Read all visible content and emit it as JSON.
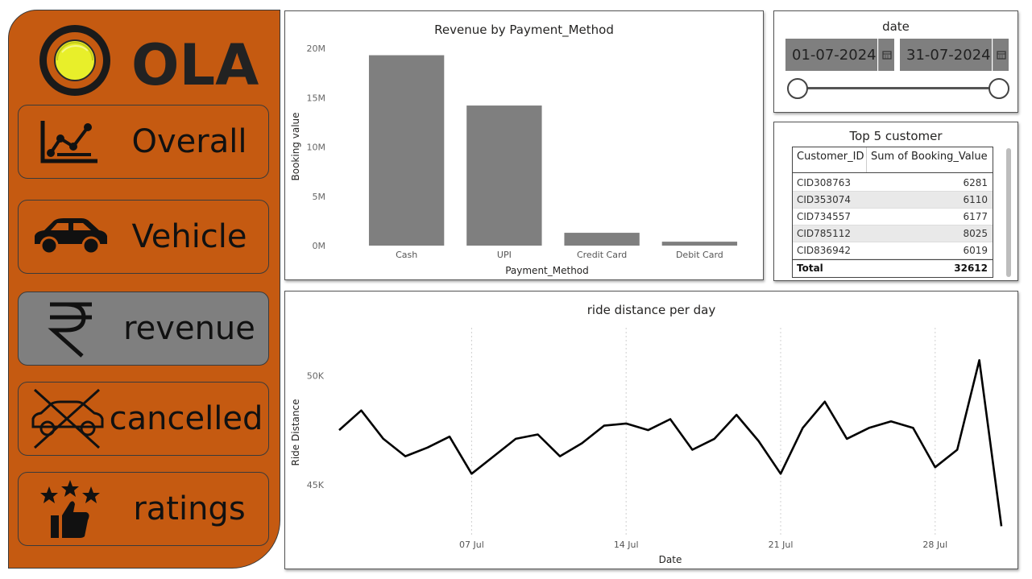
{
  "sidebar": {
    "brand": "OLA",
    "items": [
      {
        "label": "Overall",
        "icon": "line-chart-icon",
        "active": false
      },
      {
        "label": "Vehicle",
        "icon": "car-icon",
        "active": false
      },
      {
        "label": "revenue",
        "icon": "rupee-icon",
        "active": true
      },
      {
        "label": "cancelled",
        "icon": "cancelled-car-icon",
        "active": false
      },
      {
        "label": "ratings",
        "icon": "star-thumbs-up-icon",
        "active": false
      }
    ]
  },
  "colors": {
    "sidebar_bg": "#c55a11",
    "active_item": "#7f7f7f",
    "bar": "#7f7f7f",
    "line": "#000000"
  },
  "date_slicer": {
    "title": "date",
    "start": "01-07-2024",
    "end": "31-07-2024",
    "icon": "calendar-icon"
  },
  "top_customers": {
    "title": "Top 5 customer",
    "columns": [
      "Customer_ID",
      "Sum of Booking_Value"
    ],
    "rows": [
      {
        "id": "CID308763",
        "value": "6281"
      },
      {
        "id": "CID353074",
        "value": "6110"
      },
      {
        "id": "CID734557",
        "value": "6177"
      },
      {
        "id": "CID785112",
        "value": "8025"
      },
      {
        "id": "CID836942",
        "value": "6019"
      }
    ],
    "total_label": "Total",
    "total_value": "32612"
  },
  "chart_data": [
    {
      "type": "bar",
      "title": "Revenue by Payment_Method",
      "xlabel": "Payment_Method",
      "ylabel": "Booking value",
      "categories": [
        "Cash",
        "UPI",
        "Credit Card",
        "Debit Card"
      ],
      "values": [
        19300000,
        14200000,
        1300000,
        400000
      ],
      "ylim": [
        0,
        20000000
      ],
      "yticks": [
        0,
        5000000,
        10000000,
        15000000,
        20000000
      ],
      "ytick_labels": [
        "0M",
        "5M",
        "10M",
        "15M",
        "20M"
      ]
    },
    {
      "type": "line",
      "title": "ride distance per day",
      "xlabel": "Date",
      "ylabel": "Ride Distance",
      "x": [
        "2024-07-01",
        "2024-07-02",
        "2024-07-03",
        "2024-07-04",
        "2024-07-05",
        "2024-07-06",
        "2024-07-07",
        "2024-07-08",
        "2024-07-09",
        "2024-07-10",
        "2024-07-11",
        "2024-07-12",
        "2024-07-13",
        "2024-07-14",
        "2024-07-15",
        "2024-07-16",
        "2024-07-17",
        "2024-07-18",
        "2024-07-19",
        "2024-07-20",
        "2024-07-21",
        "2024-07-22",
        "2024-07-23",
        "2024-07-24",
        "2024-07-25",
        "2024-07-26",
        "2024-07-27",
        "2024-07-28",
        "2024-07-29",
        "2024-07-30",
        "2024-07-31"
      ],
      "values": [
        47500,
        48400,
        47100,
        46300,
        46700,
        47200,
        45500,
        46300,
        47100,
        47300,
        46300,
        46900,
        47700,
        47800,
        47500,
        48000,
        46600,
        47100,
        48200,
        47000,
        45500,
        47600,
        48800,
        47100,
        47600,
        47900,
        47600,
        45800,
        46600,
        50700,
        43100
      ],
      "xtick_labels": [
        "07 Jul",
        "14 Jul",
        "21 Jul",
        "28 Jul"
      ],
      "yticks": [
        45000,
        50000
      ],
      "ytick_labels": [
        "45K",
        "50K"
      ],
      "ylim": [
        42600,
        52000
      ],
      "grid": "vertical dotted"
    }
  ]
}
